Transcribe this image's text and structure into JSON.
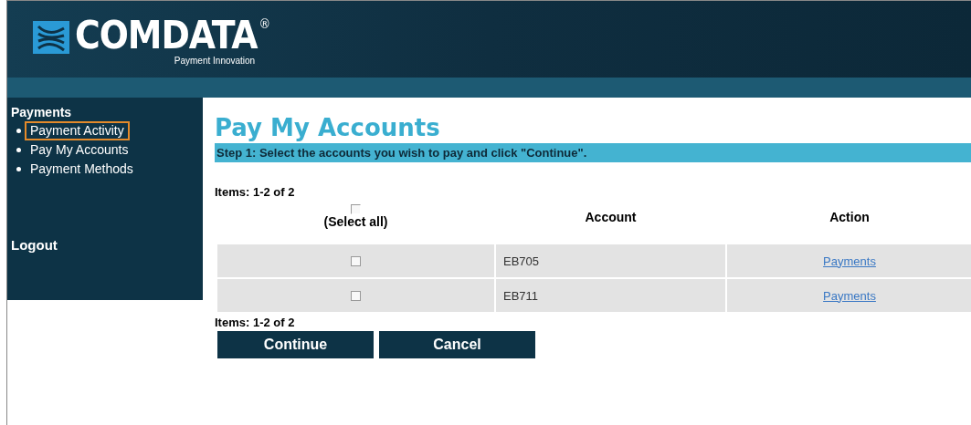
{
  "logo": {
    "name": "COMDATA",
    "mark": "®",
    "tagline": "Payment Innovation"
  },
  "sidebar": {
    "heading": "Payments",
    "items": [
      {
        "label": "Payment Activity",
        "highlighted": true
      },
      {
        "label": "Pay My Accounts",
        "highlighted": false
      },
      {
        "label": "Payment Methods",
        "highlighted": false
      }
    ],
    "logout": "Logout"
  },
  "page_title": "Pay My Accounts",
  "step": "Step 1: Select the accounts you wish to pay and click \"Continue\".",
  "items_top": "Items: 1-2 of 2",
  "table": {
    "select_all": {
      "label": "(Select all)",
      "checked": false
    },
    "columns": [
      "Account",
      "Action"
    ],
    "rows": [
      {
        "checked": false,
        "account": "EB705",
        "action": "Payments"
      },
      {
        "checked": false,
        "account": "EB711",
        "action": "Payments"
      }
    ]
  },
  "items_bottom": "Items: 1-2 of 2",
  "buttons": [
    "Continue",
    "Cancel"
  ]
}
